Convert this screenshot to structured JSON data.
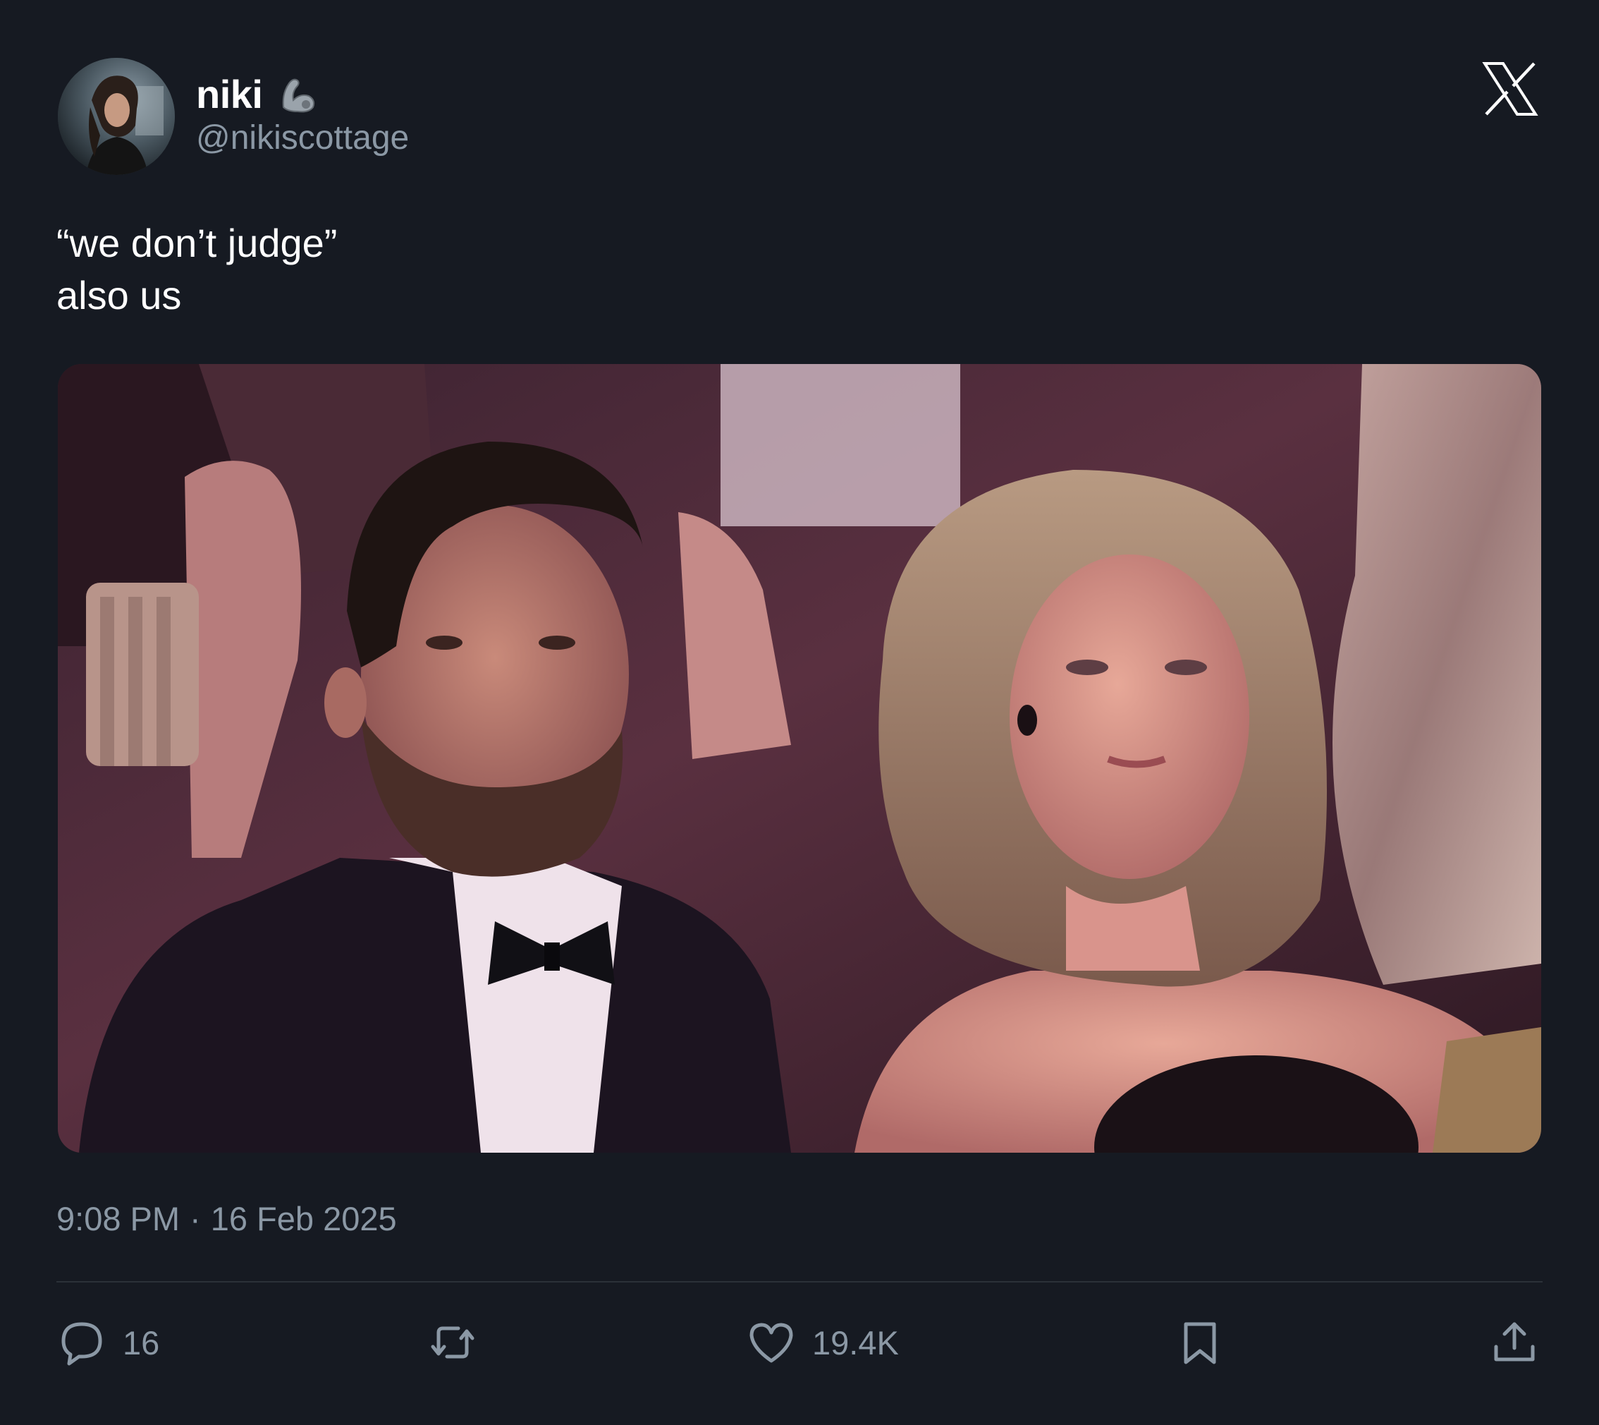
{
  "author": {
    "display_name": "niki",
    "handle": "@nikiscottage",
    "badge_icon": "flexed-arm-emoji-icon",
    "avatar_icon": "profile-avatar"
  },
  "brand": {
    "logo_icon": "x-logo-icon"
  },
  "tweet": {
    "lines": [
      "“we don’t judge”",
      "also us"
    ],
    "media_description": "photo"
  },
  "meta": {
    "time": "9:08 PM",
    "separator": "·",
    "date": "16 Feb 2025"
  },
  "actions": {
    "reply": {
      "icon": "reply-bubble-icon",
      "count": "16"
    },
    "retweet": {
      "icon": "retweet-icon",
      "count": ""
    },
    "like": {
      "icon": "heart-icon",
      "count": "19.4K"
    },
    "bookmark": {
      "icon": "bookmark-icon",
      "count": ""
    },
    "share": {
      "icon": "share-icon",
      "count": ""
    }
  },
  "colors": {
    "background": "#161a22",
    "text_primary": "#ffffff",
    "text_secondary": "#8b98a5",
    "divider": "#2b3138"
  }
}
